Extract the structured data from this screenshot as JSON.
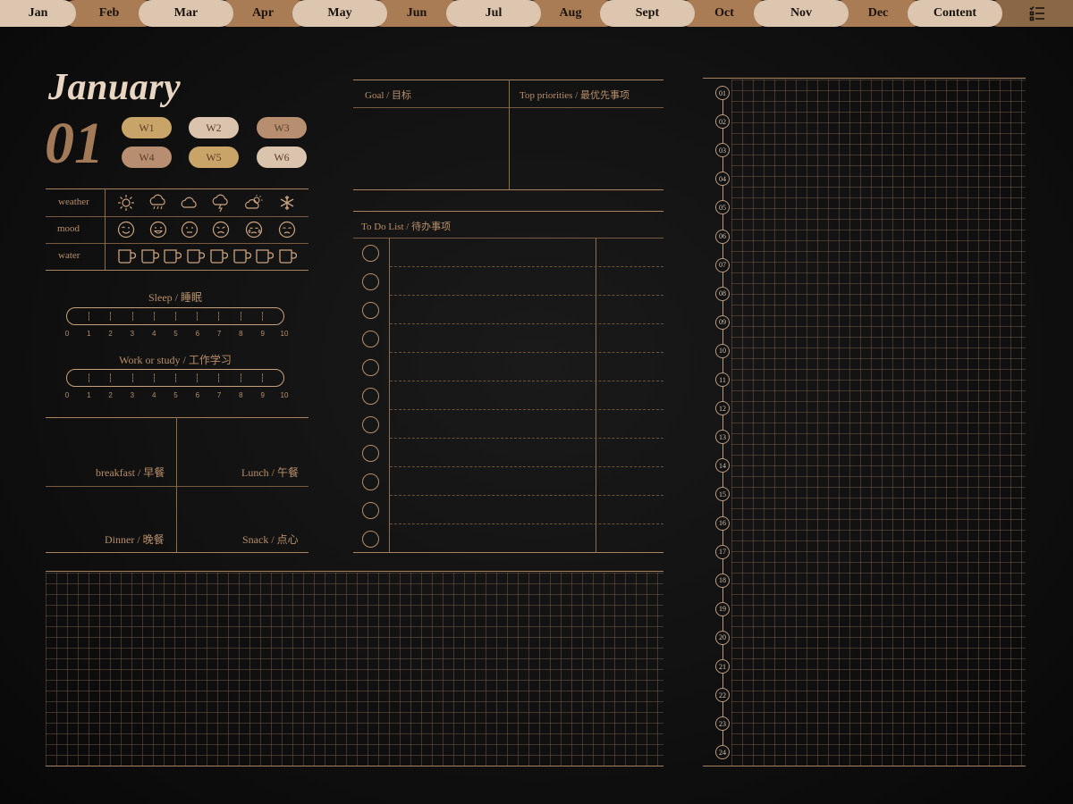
{
  "tabs": [
    {
      "label": "Jan",
      "style": "light"
    },
    {
      "label": "Feb",
      "style": "dark"
    },
    {
      "label": "Mar",
      "style": "light"
    },
    {
      "label": "Apr",
      "style": "dark"
    },
    {
      "label": "May",
      "style": "light"
    },
    {
      "label": "Jun",
      "style": "dark"
    },
    {
      "label": "Jul",
      "style": "light"
    },
    {
      "label": "Aug",
      "style": "dark"
    },
    {
      "label": "Sept",
      "style": "light"
    },
    {
      "label": "Oct",
      "style": "dark"
    },
    {
      "label": "Nov",
      "style": "light"
    },
    {
      "label": "Dec",
      "style": "dark"
    },
    {
      "label": "Content",
      "style": "light"
    }
  ],
  "menu_icon": "list-menu-icon",
  "header": {
    "month": "January",
    "day": "01"
  },
  "weeks": [
    {
      "label": "W1",
      "color": "#c9a468"
    },
    {
      "label": "W2",
      "color": "#dbc4ad"
    },
    {
      "label": "W3",
      "color": "#b78f70"
    },
    {
      "label": "W4",
      "color": "#b78f70"
    },
    {
      "label": "W5",
      "color": "#c9a468"
    },
    {
      "label": "W6",
      "color": "#dbc4ad"
    }
  ],
  "tracker": {
    "weather_label": "weather",
    "mood_label": "mood",
    "water_label": "water",
    "weather_icons": [
      "sun-icon",
      "rain-cloud-icon",
      "cloud-icon",
      "thunderstorm-icon",
      "partly-cloudy-icon",
      "snowflake-icon"
    ],
    "mood_icons": [
      "wink-face-icon",
      "grin-face-icon",
      "neutral-face-icon",
      "frown-face-icon",
      "crying-face-icon",
      "sad-face-icon"
    ],
    "water_cups": 8
  },
  "sleep": {
    "label": "Sleep / 睡眠",
    "ticks": [
      "0",
      "1",
      "2",
      "3",
      "4",
      "5",
      "6",
      "7",
      "8",
      "9",
      "10"
    ]
  },
  "work": {
    "label": "Work or study / 工作学习",
    "ticks": [
      "0",
      "1",
      "2",
      "3",
      "4",
      "5",
      "6",
      "7",
      "8",
      "9",
      "10"
    ]
  },
  "meals": {
    "breakfast": "breakfast / 早餐",
    "lunch": "Lunch / 午餐",
    "dinner": "Dinner / 晚餐",
    "snack": "Snack / 点心"
  },
  "goal": {
    "label": "Goal / 目标"
  },
  "priorities": {
    "label": "Top priorities / 最优先事项"
  },
  "todo": {
    "label": "To Do List / 待办事项",
    "rows": 11
  },
  "hours": [
    "01",
    "02",
    "03",
    "04",
    "05",
    "06",
    "07",
    "08",
    "09",
    "10",
    "11",
    "12",
    "13",
    "14",
    "15",
    "16",
    "17",
    "18",
    "19",
    "20",
    "21",
    "22",
    "23",
    "24"
  ],
  "colors": {
    "accent": "#a97c55",
    "light_tab": "#dcc6b0",
    "line": "#a9835f",
    "background": "#111111"
  }
}
